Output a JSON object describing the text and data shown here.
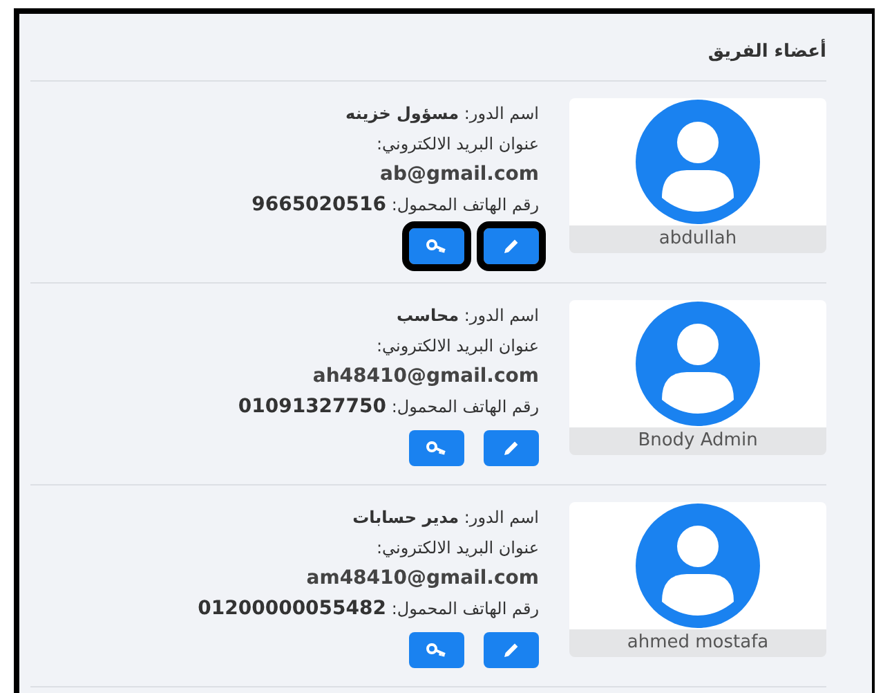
{
  "title": "أعضاء الفريق",
  "members": [
    {
      "name": "abdullah",
      "role": "اسم الدور: **مسؤول خزينه**",
      "email_label": "عنوان البريد الالكتروني:",
      "email": "ab@gmail.com",
      "phone": "رقم الهاتف المحمول: **9665020516**",
      "buttons": [
        {
          "kind": "edit",
          "outlined": true
        },
        {
          "kind": "key",
          "outlined": true
        }
      ]
    },
    {
      "name": "Bnody Admin",
      "role": "اسم الدور: **محاسب**",
      "email_label": "عنوان البريد الالكتروني:",
      "email": "ah48410@gmail.com",
      "phone": "رقم الهاتف المحمول: **01091327750**",
      "buttons": [
        {
          "kind": "edit",
          "outlined": false
        },
        {
          "kind": "key",
          "outlined": false
        }
      ]
    },
    {
      "name": "ahmed mostafa",
      "role": "اسم الدور: **مدير حسابات**",
      "email_label": "عنوان البريد الالكتروني:",
      "email": "am48410@gmail.com",
      "phone": "رقم الهاتف المحمول: **01200000055482**",
      "buttons": [
        {
          "kind": "edit",
          "outlined": false
        },
        {
          "kind": "key",
          "outlined": false
        }
      ]
    }
  ]
}
